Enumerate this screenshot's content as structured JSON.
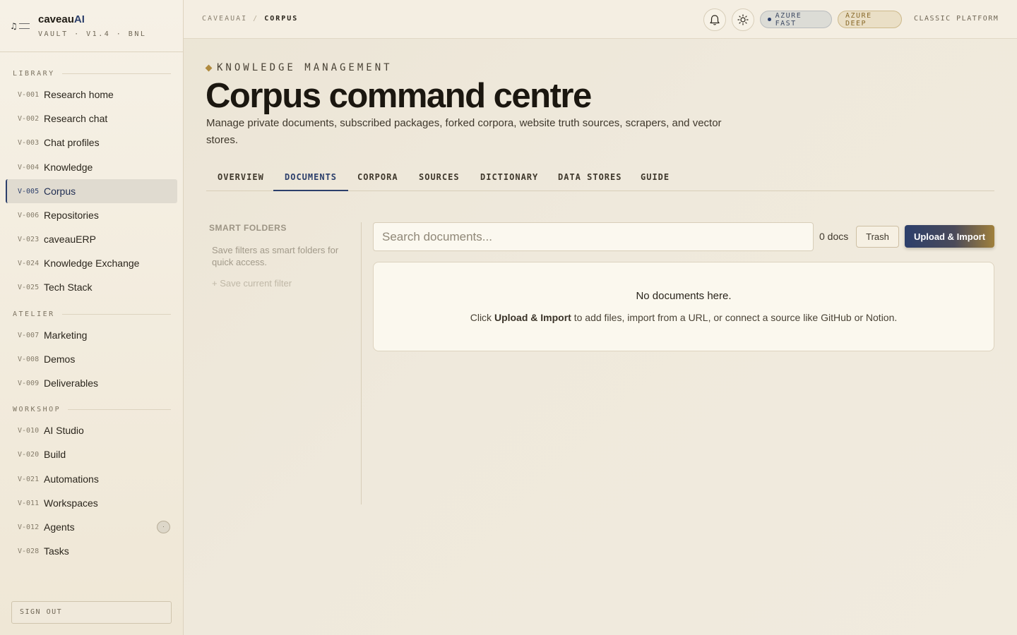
{
  "brand": {
    "name_prefix": "caveau",
    "name_suffix": "AI",
    "subtitle": "VAULT · V1.4 · BNL"
  },
  "sidebar": {
    "sections": [
      {
        "title": "LIBRARY"
      },
      {
        "title": "ATELIER"
      },
      {
        "title": "WORKSHOP"
      }
    ],
    "items": [
      {
        "code": "V-001",
        "label": "Research home"
      },
      {
        "code": "V-002",
        "label": "Research chat"
      },
      {
        "code": "V-003",
        "label": "Chat profiles"
      },
      {
        "code": "V-004",
        "label": "Knowledge"
      },
      {
        "code": "V-005",
        "label": "Corpus",
        "active": true
      },
      {
        "code": "V-006",
        "label": "Repositories"
      },
      {
        "code": "V-023",
        "label": "caveauERP"
      },
      {
        "code": "V-024",
        "label": "Knowledge Exchange"
      },
      {
        "code": "V-025",
        "label": "Tech Stack"
      },
      {
        "code": "V-007",
        "label": "Marketing"
      },
      {
        "code": "V-008",
        "label": "Demos"
      },
      {
        "code": "V-009",
        "label": "Deliverables"
      },
      {
        "code": "V-010",
        "label": "AI Studio"
      },
      {
        "code": "V-020",
        "label": "Build"
      },
      {
        "code": "V-021",
        "label": "Automations"
      },
      {
        "code": "V-011",
        "label": "Workspaces"
      },
      {
        "code": "V-012",
        "label": "Agents",
        "badge": "·"
      },
      {
        "code": "V-028",
        "label": "Tasks"
      }
    ],
    "sign_out": "SIGN OUT"
  },
  "topbar": {
    "breadcrumb_root": "CAVEAUAI",
    "breadcrumb_sep": "/",
    "breadcrumb_current": "CORPUS",
    "pill_fast": "AZURE FAST",
    "pill_deep": "AZURE DEEP",
    "classic": "CLASSIC PLATFORM",
    "icons": [
      "bell-icon",
      "sun-icon"
    ]
  },
  "header": {
    "eyebrow": "KNOWLEDGE MANAGEMENT",
    "title": "Corpus command centre",
    "description": "Manage private documents, subscribed packages, forked corpora, website truth sources, scrapers, and vector stores."
  },
  "tabs": [
    {
      "label": "OVERVIEW"
    },
    {
      "label": "DOCUMENTS",
      "active": true
    },
    {
      "label": "CORPORA"
    },
    {
      "label": "SOURCES"
    },
    {
      "label": "DICTIONARY"
    },
    {
      "label": "DATA STORES"
    },
    {
      "label": "GUIDE"
    }
  ],
  "smart_folders": {
    "title": "SMART FOLDERS",
    "description": "Save filters as smart folders for quick access.",
    "save_link": "+ Save current filter"
  },
  "documents": {
    "search_placeholder": "Search documents...",
    "count": "0 docs",
    "trash_label": "Trash",
    "upload_label": "Upload & Import",
    "empty_title": "No documents here.",
    "empty_pre": "Click ",
    "empty_bold": "Upload & Import",
    "empty_post": " to add files, import from a URL, or connect a source like GitHub or Notion."
  },
  "colors": {
    "accent_navy": "#2c3f6b",
    "accent_gold": "#b08a3e",
    "background": "#efe9dc"
  }
}
